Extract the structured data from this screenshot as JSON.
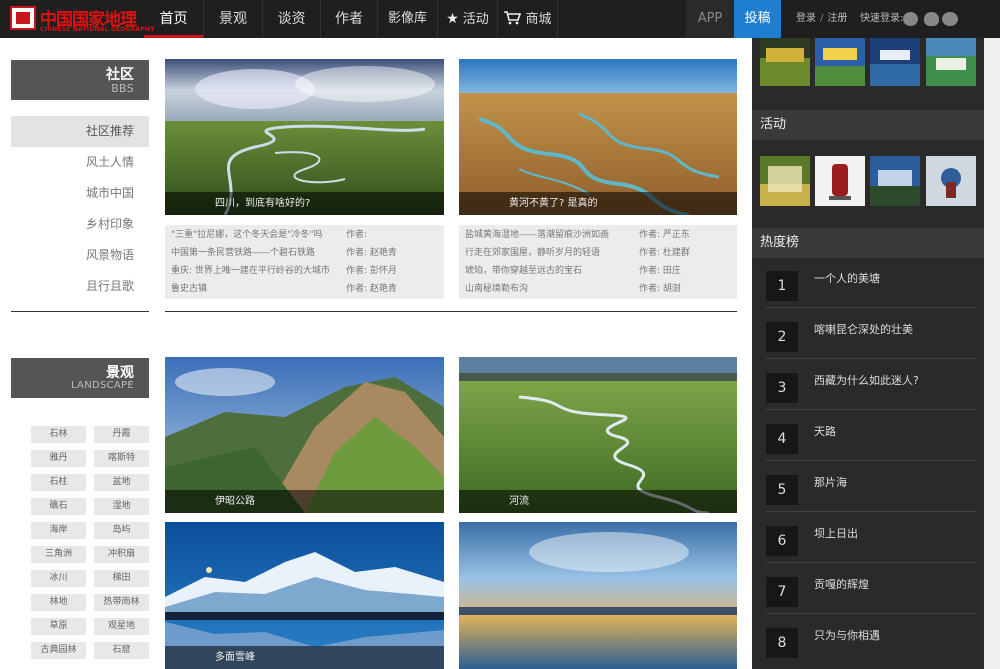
{
  "brand": {
    "logo_cn": "中国国家地理",
    "logo_en": "CHINESE NATIONAL GEOGRAPHY"
  },
  "nav": {
    "items": [
      "首页",
      "景观",
      "谈资",
      "作者",
      "影像库",
      "活动",
      "商城"
    ],
    "app": "APP",
    "contribute": "投稿",
    "login": "登录",
    "register": "注册",
    "login_sep": "/",
    "quick_login": "快速登录:"
  },
  "community": {
    "title": "社区",
    "subtitle": "BBS",
    "categories": [
      "社区推荐",
      "风土人情",
      "城市中国",
      "乡村印象",
      "风景物语",
      "且行且歌"
    ],
    "cards": [
      {
        "caption": "四川，到底有啥好的?",
        "articles": [
          {
            "title": "\"三重\"拉尼娜，这个冬天会是\"冷冬\"吗",
            "author": "作者:"
          },
          {
            "title": "中国第一条民营铁路——个碧石铁路",
            "author": "作者: 赵艳青"
          },
          {
            "title": "重庆: 世界上唯一建在平行岭谷的大城市",
            "author": "作者: 彭怀月"
          },
          {
            "title": "鲁史古镇",
            "author": "作者: 赵艳青"
          }
        ]
      },
      {
        "caption": "黄河不黄了? 是真的",
        "articles": [
          {
            "title": "盐城黄海湿地——落潮留痕沙洲如画",
            "author": "作者: 严正东"
          },
          {
            "title": "行走在郊家国屋，静听岁月的轻语",
            "author": "作者: 杜建群"
          },
          {
            "title": "琥珀，带你穿越至远古的宝石",
            "author": "作者: 田庄"
          },
          {
            "title": "山南秘境勒布沟",
            "author": "作者: 胡澍"
          }
        ]
      }
    ]
  },
  "landscape": {
    "title": "景观",
    "subtitle": "LANDSCAPE",
    "tags": [
      "石林",
      "丹霞",
      "雅丹",
      "喀斯特",
      "石柱",
      "盆地",
      "礁石",
      "湿地",
      "海岸",
      "岛屿",
      "三角洲",
      "冲积扇",
      "冰川",
      "梯田",
      "林地",
      "热带雨林",
      "草原",
      "观星地",
      "古典园林",
      "石窟"
    ],
    "cards": [
      "伊昭公路",
      "河流",
      "多面雪峰",
      ""
    ]
  },
  "right": {
    "activity_title": "活动",
    "hot_title": "热度榜",
    "hot_list": [
      {
        "num": "1",
        "title": "一个人的美塘"
      },
      {
        "num": "2",
        "title": "喀喇昆仑深处的壮美"
      },
      {
        "num": "3",
        "title": "西藏为什么如此迷人?"
      },
      {
        "num": "4",
        "title": "天路"
      },
      {
        "num": "5",
        "title": "那片海"
      },
      {
        "num": "6",
        "title": "坝上日出"
      },
      {
        "num": "7",
        "title": "贡嘎的辉煌"
      },
      {
        "num": "8",
        "title": "只为与你相遇"
      }
    ]
  },
  "colors": {
    "nav_bg": "#1f1f1f",
    "accent_red": "#d1121c",
    "contribute_blue": "#1f7ed0",
    "sidebar_dark": "#2a2a2a"
  }
}
